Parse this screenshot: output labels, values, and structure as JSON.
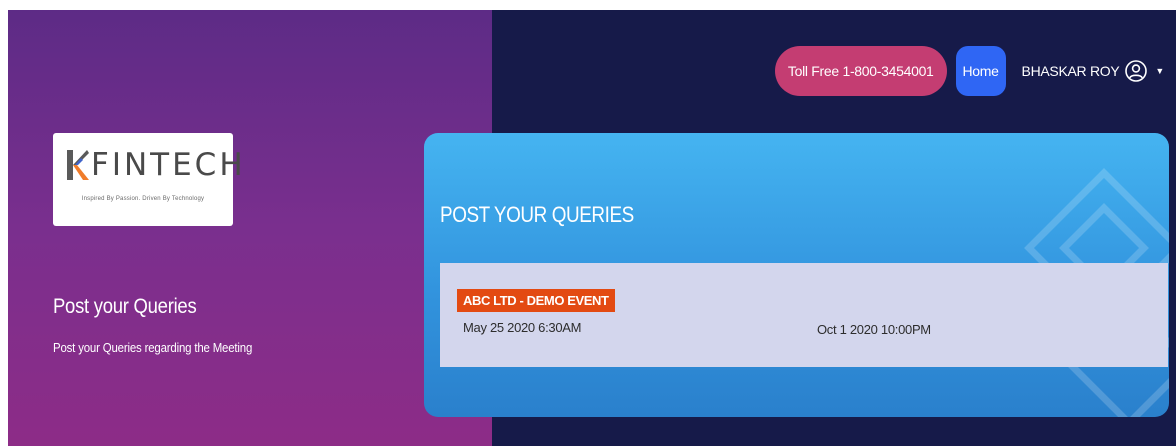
{
  "brand": {
    "name": "FINTECH",
    "tagline": "Inspired By Passion. Driven By Technology"
  },
  "left_panel": {
    "title": "Post your Queries",
    "subtitle": "Post your Queries regarding the Meeting"
  },
  "nav": {
    "toll_free": "Toll Free 1-800-3454001",
    "home": "Home",
    "user_name": "BHASKAR ROY",
    "user_icon": "user-circle-icon",
    "caret_icon": "caret-down-icon"
  },
  "card": {
    "title": "POST YOUR QUERIES"
  },
  "events": [
    {
      "name": "ABC LTD - DEMO EVENT",
      "start": "May 25 2020 6:30AM",
      "end": "Oct 1 2020 10:00PM"
    }
  ],
  "colors": {
    "left_gradient_top": "#5d2b86",
    "left_gradient_bottom": "#8d2c87",
    "page_bg": "#161a49",
    "toll_button": "#c43d72",
    "home_button": "#2f66f4",
    "card": "#3ba6ea",
    "event_row": "#d3d6ed",
    "badge": "#e34a12"
  }
}
